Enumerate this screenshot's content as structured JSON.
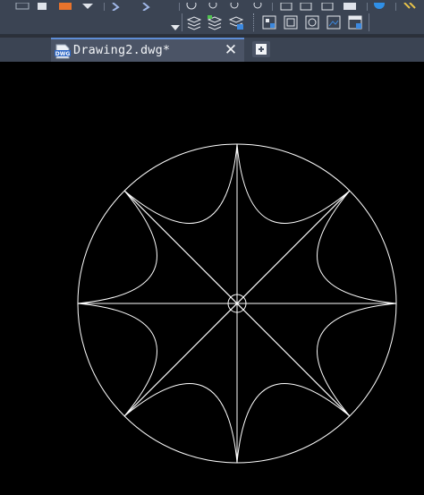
{
  "tab": {
    "label": "Drawing2.dwg*",
    "icon_text": "DWG",
    "close_glyph": "✕",
    "add_glyph": "+"
  },
  "icons": {
    "file": "dwg-file-icon",
    "close": "close-icon",
    "new_tab": "add-tab-icon",
    "toolbar_top": [
      "bind-icon",
      "copy-icon",
      "paste-icon",
      "dropdown-icon",
      "undo-icon",
      "redo-icon",
      "rotate-icon",
      "zoom-icon",
      "zoom-extents-icon",
      "zoom-realtime-icon",
      "view-1-icon",
      "view-2-icon",
      "view-3-icon",
      "view-4-icon",
      "help-icon",
      "more-icon"
    ],
    "toolbar_row": [
      "dropdown-arrow-icon",
      "layer-state-icon",
      "layer-properties-icon",
      "layer-previous-icon",
      "block-icon",
      "frame-icon",
      "circle-frame-icon",
      "image-icon",
      "window-icon"
    ]
  },
  "colors": {
    "toolbar_bg": "#3b4453",
    "tab_active": "#4b5466",
    "tab_accent": "#5e8dd6",
    "canvas_bg": "#000000",
    "geometry": "#ffffff"
  }
}
